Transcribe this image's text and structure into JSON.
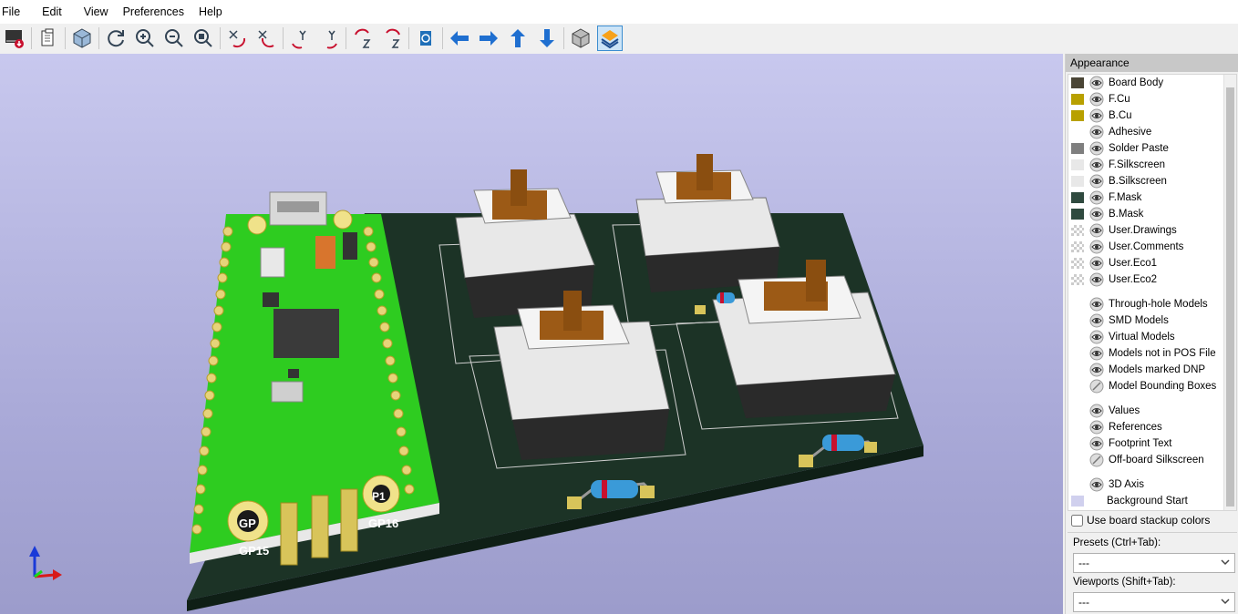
{
  "menu": [
    "File",
    "Edit",
    "View",
    "Preferences",
    "Help"
  ],
  "toolbar": {
    "icons": [
      "render-icon",
      "copy-icon",
      "view3d-icon",
      "refresh-icon",
      "zoom-in-icon",
      "zoom-out-icon",
      "zoom-fit-icon",
      "rotate-x-cw-icon",
      "rotate-x-ccw-icon",
      "rotate-y-cw-icon",
      "rotate-y-ccw-icon",
      "rotate-z-cw-icon",
      "rotate-z-ccw-icon",
      "flip-board-icon",
      "pan-left-icon",
      "pan-right-icon",
      "pan-up-icon",
      "pan-down-icon",
      "ortho-icon",
      "layers-toggle-icon"
    ]
  },
  "appearance": {
    "title": "Appearance",
    "layers": [
      {
        "label": "Board Body",
        "color": "#4a4535",
        "eye": "visible"
      },
      {
        "label": "F.Cu",
        "color": "#b8a000",
        "eye": "visible"
      },
      {
        "label": "B.Cu",
        "color": "#b8a000",
        "eye": "visible"
      },
      {
        "label": "Adhesive",
        "color": "",
        "eye": "visible"
      },
      {
        "label": "Solder Paste",
        "color": "#7f7f7f",
        "eye": "visible"
      },
      {
        "label": "F.Silkscreen",
        "color": "#e8e8e8",
        "eye": "visible"
      },
      {
        "label": "B.Silkscreen",
        "color": "#e8e8e8",
        "eye": "visible"
      },
      {
        "label": "F.Mask",
        "color": "#2f4a3f",
        "eye": "visible"
      },
      {
        "label": "B.Mask",
        "color": "#2f4a3f",
        "eye": "visible"
      },
      {
        "label": "User.Drawings",
        "color": "checker",
        "eye": "visible"
      },
      {
        "label": "User.Comments",
        "color": "checker",
        "eye": "visible"
      },
      {
        "label": "User.Eco1",
        "color": "checker",
        "eye": "visible"
      },
      {
        "label": "User.Eco2",
        "color": "checker",
        "eye": "visible"
      }
    ],
    "models": [
      {
        "label": "Through-hole Models",
        "eye": "visible"
      },
      {
        "label": "SMD Models",
        "eye": "visible"
      },
      {
        "label": "Virtual Models",
        "eye": "visible"
      },
      {
        "label": "Models not in POS File",
        "eye": "visible"
      },
      {
        "label": "Models marked DNP",
        "eye": "visible"
      },
      {
        "label": "Model Bounding Boxes",
        "eye": "hidden"
      }
    ],
    "text": [
      {
        "label": "Values",
        "eye": "visible"
      },
      {
        "label": "References",
        "eye": "visible"
      },
      {
        "label": "Footprint Text",
        "eye": "visible"
      },
      {
        "label": "Off-board Silkscreen",
        "eye": "hidden"
      }
    ],
    "misc": [
      {
        "label": "3D Axis",
        "eye": "visible"
      },
      {
        "label": "Background Start",
        "color": "#d0d0ee"
      }
    ],
    "stackup_label": "Use board stackup colors",
    "presets_label": "Presets (Ctrl+Tab):",
    "presets_value": "---",
    "viewports_label": "Viewports (Shift+Tab):",
    "viewports_value": "---"
  },
  "board_labels": {
    "gp15": "GP15",
    "gp16": "GP16",
    "p1": "P1",
    "gp": "GP"
  }
}
